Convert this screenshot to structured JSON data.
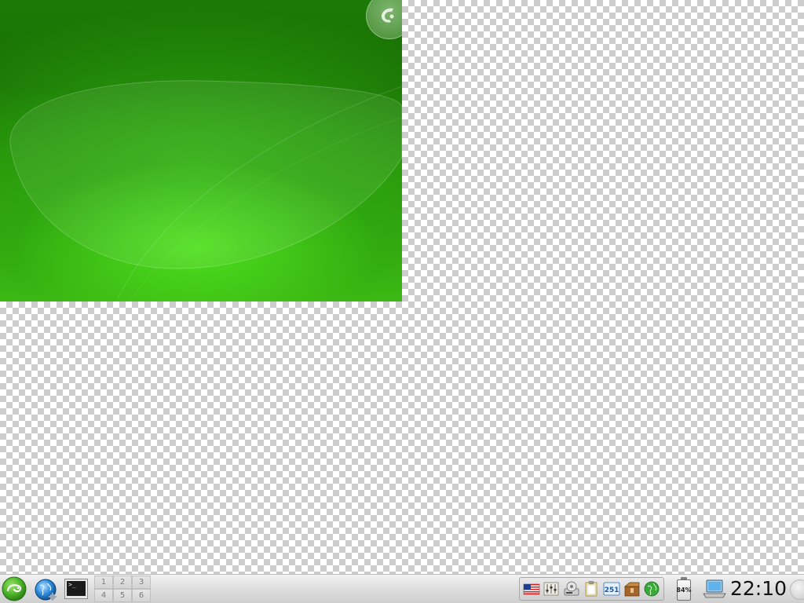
{
  "desktop": {
    "background": "transparent-checkerboard",
    "wallpaper": {
      "accent_color": "#2fae10",
      "cashew_icon": "plasma-cashew-icon"
    }
  },
  "panel": {
    "launchers": [
      {
        "icon": "opensuse-kickoff-icon"
      },
      {
        "icon": "web-browser-globe-icon"
      },
      {
        "icon": "terminal-icon",
        "prompt": ">_"
      }
    ],
    "pager": {
      "desktops": [
        "1",
        "2",
        "3",
        "4",
        "5",
        "6"
      ]
    },
    "system_tray": {
      "items": [
        {
          "icon": "keyboard-layout-us-flag-icon"
        },
        {
          "icon": "audio-mixer-icon"
        },
        {
          "icon": "hardware-device-icon"
        },
        {
          "icon": "clipboard-icon"
        },
        {
          "icon": "software-updates-icon",
          "count": "251"
        },
        {
          "icon": "package-installer-icon"
        },
        {
          "icon": "network-globe-icon"
        }
      ]
    },
    "battery": {
      "percent": "84%"
    },
    "network_icon": "network-laptop-icon",
    "clock": {
      "time": "22:10"
    },
    "toolbox_icon": "panel-toolbox-icon"
  }
}
